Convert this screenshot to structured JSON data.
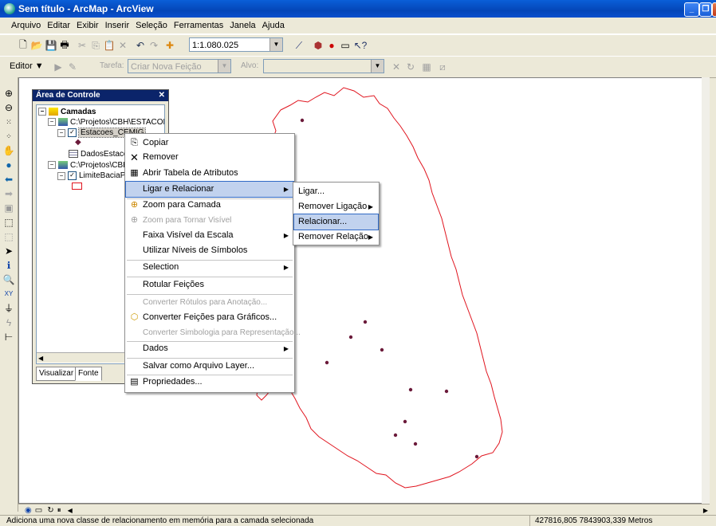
{
  "window": {
    "title": "Sem título - ArcMap - ArcView"
  },
  "menubar": [
    "Arquivo",
    "Editar",
    "Exibir",
    "Inserir",
    "Seleção",
    "Ferramentas",
    "Janela",
    "Ajuda"
  ],
  "toolbar": {
    "scale": "1:1.080.025",
    "editor_label": "Editor ▼",
    "task_label": "Tarefa:",
    "task_value": "Criar Nova Feição",
    "target_label": "Alvo:",
    "target_value": ""
  },
  "toc": {
    "title": "Área de Controle",
    "root": "Camadas",
    "path1": "C:\\Projetos\\CBH\\ESTACOE",
    "layer1": "Estacoes_CEMIG",
    "table1": "DadosEstaco",
    "path2": "C:\\Projetos\\CBH",
    "layer2": "LimiteBaciaP",
    "tabs": [
      "Visualizar",
      "Fonte"
    ]
  },
  "context_menu": {
    "items": [
      "Copiar",
      "Remover",
      "Abrir Tabela de Atributos",
      "Ligar e Relacionar",
      "Zoom para Camada",
      "Zoom para Tornar Visível",
      "Faixa Visível da Escala",
      "Utilizar Níveis de Símbolos",
      "Selection",
      "Rotular Feições",
      "Converter Rótulos para Anotação...",
      "Converter Feições para Gráficos...",
      "Converter Simbologia para Representação...",
      "Dados",
      "Salvar como Arquivo Layer...",
      "Propriedades..."
    ]
  },
  "submenu": {
    "items": [
      "Ligar...",
      "Remover Ligação",
      "Relacionar...",
      "Remover Relação"
    ]
  },
  "status": {
    "message": "Adiciona uma nova classe de relacionamento em memória para a camada selecionada",
    "coords": "427816,805  7843903,339 Metros"
  },
  "colors": {
    "boundary": "#e0141e",
    "station": "#6b1a3a",
    "highlight": "#c1d2ee",
    "titlebar": "#0a5fd8"
  }
}
